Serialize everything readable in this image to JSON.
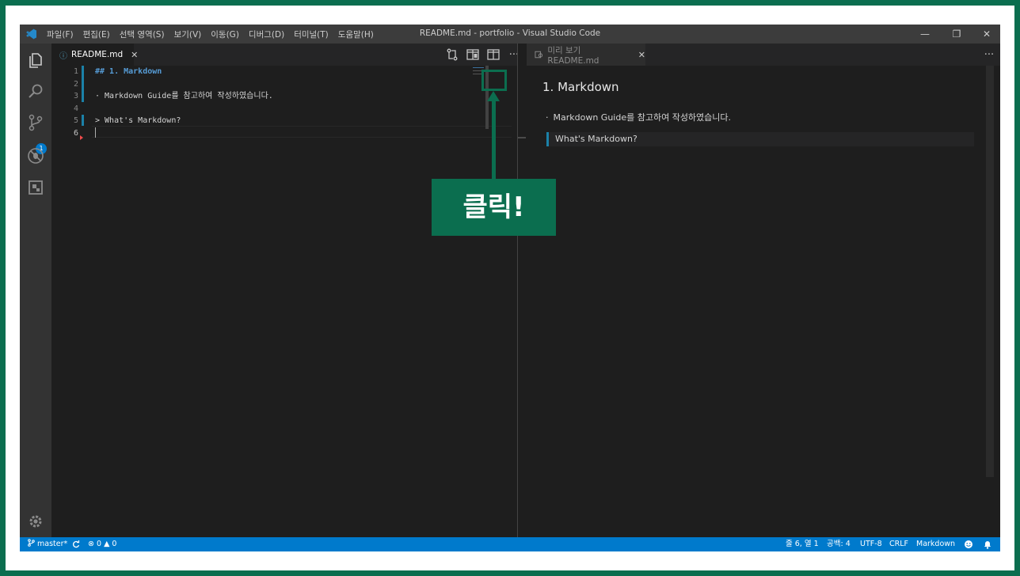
{
  "titlebar": {
    "menu": [
      "파일(F)",
      "편집(E)",
      "선택 영역(S)",
      "보기(V)",
      "이동(G)",
      "디버그(D)",
      "터미널(T)",
      "도움말(H)"
    ],
    "window_title": "README.md - portfolio - Visual Studio Code",
    "minimize": "—",
    "restore": "❐",
    "close": "✕"
  },
  "activity": {
    "scm_badge": "1",
    "icons": [
      "files-icon",
      "search-icon",
      "source-control-icon",
      "debug-icon",
      "extensions-icon",
      "gear-icon"
    ]
  },
  "editor": {
    "tab_icon": "ⓘ",
    "tab_label": "README.md",
    "tab_close": "✕",
    "line_numbers": [
      "1",
      "2",
      "3",
      "4",
      "5",
      "6"
    ],
    "lines": [
      "## 1. Markdown",
      "",
      "· Markdown Guide를 참고하여 작성하였습니다.",
      "",
      "> What's Markdown?",
      ""
    ],
    "more_actions": "···"
  },
  "preview": {
    "tab_label": "미리 보기 README.md",
    "tab_close": "✕",
    "more_actions": "···",
    "heading": "1. Markdown",
    "list_item": "Markdown Guide를 참고하여 작성하였습니다.",
    "blockquote": "What's Markdown?"
  },
  "statusbar": {
    "branch": "master*",
    "errors": "0",
    "warnings": "0",
    "position": "줄 6, 열 1",
    "spaces": "공백: 4",
    "encoding": "UTF-8",
    "eol": "CRLF",
    "language": "Markdown"
  },
  "callout": {
    "text": "클릭!"
  },
  "colors": {
    "accent": "#007acc",
    "callout": "#0b6e4f"
  }
}
